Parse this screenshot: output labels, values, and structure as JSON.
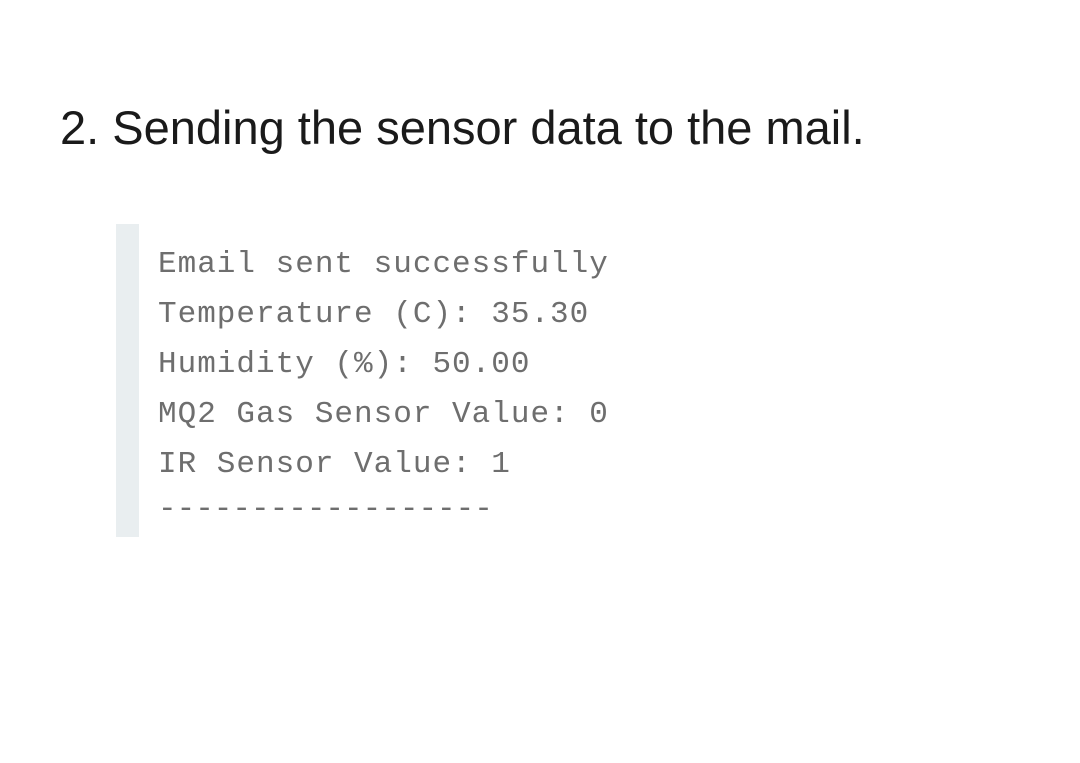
{
  "heading": "2. Sending the sensor data to the mail.",
  "serial_output": {
    "lines": [
      "Email sent successfully",
      "Temperature (C): 35.30",
      "Humidity (%): 50.00",
      "MQ2 Gas Sensor Value: 0",
      "IR Sensor Value: 1"
    ],
    "separator": "------------------"
  }
}
